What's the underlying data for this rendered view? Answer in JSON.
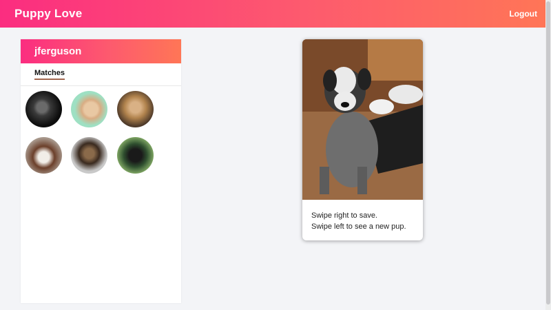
{
  "app": {
    "title": "Puppy Love"
  },
  "header": {
    "logout_label": "Logout"
  },
  "sidebar": {
    "username": "jferguson",
    "tabs": [
      {
        "label": "Matches",
        "active": true
      }
    ],
    "matches": [
      {
        "icon": "dog-avatar-icon"
      },
      {
        "icon": "dog-avatar-icon"
      },
      {
        "icon": "dog-avatar-icon"
      },
      {
        "icon": "dog-avatar-icon"
      },
      {
        "icon": "dog-avatar-icon"
      },
      {
        "icon": "dog-avatar-icon"
      }
    ]
  },
  "card": {
    "lines": [
      "Swipe right to save.",
      "Swipe left to see a new pup."
    ]
  },
  "colors": {
    "brand_gradient_start": "#fb2d80",
    "brand_gradient_end": "#ff7656",
    "tab_underline": "#a1664f",
    "background": "#f3f4f7"
  }
}
